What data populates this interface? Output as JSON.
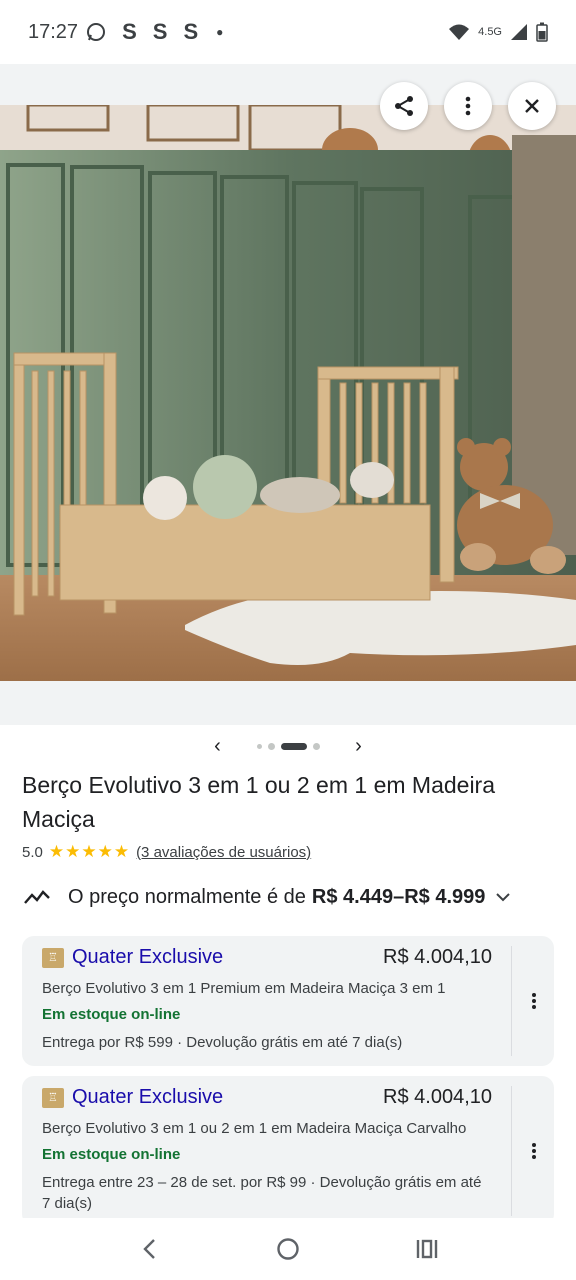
{
  "status_bar": {
    "time": "17:27",
    "indicators": [
      "S",
      "S",
      "S"
    ],
    "network": "4.5G",
    "icons": [
      "whatsapp-icon",
      "hotspot-icon",
      "signal-icon",
      "battery-icon"
    ]
  },
  "hero": {
    "buttons": [
      "share-icon",
      "more-vert-icon",
      "close-icon"
    ],
    "pager": {
      "total": 4,
      "active_index": 2
    }
  },
  "product": {
    "title": "Berço Evolutivo 3 em 1 ou 2 em 1 em Madeira Maciça",
    "rating": "5.0",
    "stars": "★★★★★",
    "reviews": "(3 avaliações de usuários)",
    "price_prefix": "O preço normalmente é de",
    "price_range": "R$ 4.449–R$ 4.999"
  },
  "offers": [
    {
      "store": "Quater Exclusive",
      "price": "R$ 4.004,10",
      "description": "Berço Evolutivo 3 em 1 Premium em Madeira Maciça 3 em 1",
      "stock": "Em estoque on-line",
      "shipping": "Entrega por R$ 599 · Devolução grátis em até 7 dia(s)"
    },
    {
      "store": "Quater Exclusive",
      "price": "R$ 4.004,10",
      "description": "Berço Evolutivo 3 em 1 ou 2 em 1 em Madeira Maciça Carvalho",
      "stock": "Em estoque on-line",
      "shipping": "Entrega entre 23 – 28 de set. por R$ 99 · Devolução grátis em até 7 dia(s)"
    }
  ],
  "colors": {
    "link": "#1a0dab",
    "stock": "#137333",
    "star": "#fbbc04",
    "card_bg": "#f1f3f4"
  }
}
